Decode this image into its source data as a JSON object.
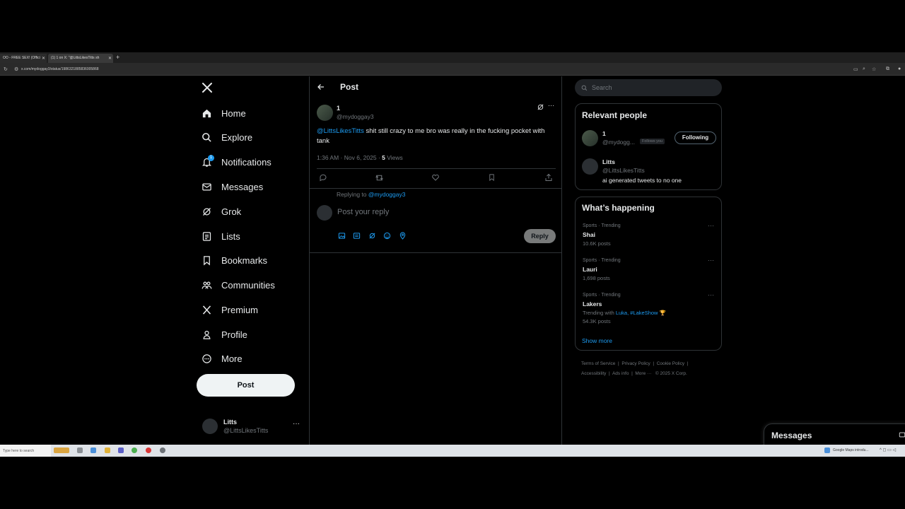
{
  "browser": {
    "tabs": [
      {
        "label": "OO - FREE SEX! (Offici",
        "active": false
      },
      {
        "label": "(1) 1 on X: \"@LittsLikesTitts sh",
        "active": true
      }
    ],
    "url": "x.com/mydoggay3/status/1986321885836005868"
  },
  "nav": {
    "items": [
      {
        "label": "Home",
        "icon": "home-icon"
      },
      {
        "label": "Explore",
        "icon": "search-icon"
      },
      {
        "label": "Notifications",
        "icon": "bell-icon"
      },
      {
        "label": "Messages",
        "icon": "envelope-icon"
      },
      {
        "label": "Grok",
        "icon": "grok-icon"
      },
      {
        "label": "Lists",
        "icon": "list-icon"
      },
      {
        "label": "Bookmarks",
        "icon": "bookmark-icon"
      },
      {
        "label": "Communities",
        "icon": "people-icon"
      },
      {
        "label": "Premium",
        "icon": "x-logo-icon"
      },
      {
        "label": "Profile",
        "icon": "person-icon"
      },
      {
        "label": "More",
        "icon": "more-circle-icon"
      }
    ],
    "notification_count": "1",
    "post_button": "Post",
    "account": {
      "name": "Litts",
      "handle": "@LittsLikesTitts",
      "more": "···"
    }
  },
  "main": {
    "header_title": "Post",
    "tweet": {
      "author_name": "1",
      "author_handle": "@mydoggay3",
      "mention": "@LittsLikesTitts",
      "text": " shit still crazy to me bro was really in the fucking pocket with tank",
      "time": "1:36 AM · Nov 6, 2025 · ",
      "views_count": "5",
      "views_label": " Views"
    },
    "reply": {
      "replying_to_label": "Replying to ",
      "replying_to_handle": "@mydoggay3",
      "placeholder": "Post your reply",
      "button": "Reply"
    }
  },
  "sidebar": {
    "search_placeholder": "Search",
    "relevant_people": {
      "title": "Relevant people",
      "people": [
        {
          "name": "1",
          "handle": "@mydogg...",
          "badge": "Follows you",
          "button": "Following"
        },
        {
          "name": "Litts",
          "handle": "@LittsLikesTitts",
          "bio": "ai generated tweets to no one"
        }
      ]
    },
    "whats_happening": {
      "title": "What’s happening",
      "trends": [
        {
          "category": "Sports · Trending",
          "name": "Shai",
          "count": "10.6K posts"
        },
        {
          "category": "Sports · Trending",
          "name": "Lauri",
          "count": "1,698 posts"
        },
        {
          "category": "Sports · Trending",
          "name": "Lakers",
          "context_prefix": "Trending with ",
          "context_links": "Luka, #LakeShow",
          "context_emoji": "🏆",
          "count": "54.3K posts"
        }
      ],
      "show_more": "Show more"
    },
    "footer": [
      "Terms of Service",
      "Privacy Policy",
      "Cookie Policy",
      "Accessibility",
      "Ads info",
      "More ···",
      "© 2025 X Corp."
    ]
  },
  "messages_drawer": {
    "title": "Messages"
  },
  "taskbar": {
    "search_placeholder": "Type here to search",
    "notification": "Google Maps introdu..."
  },
  "colors": {
    "accent": "#1d9bf0",
    "background": "#000000",
    "border": "#2f3336",
    "muted": "#71767b"
  }
}
